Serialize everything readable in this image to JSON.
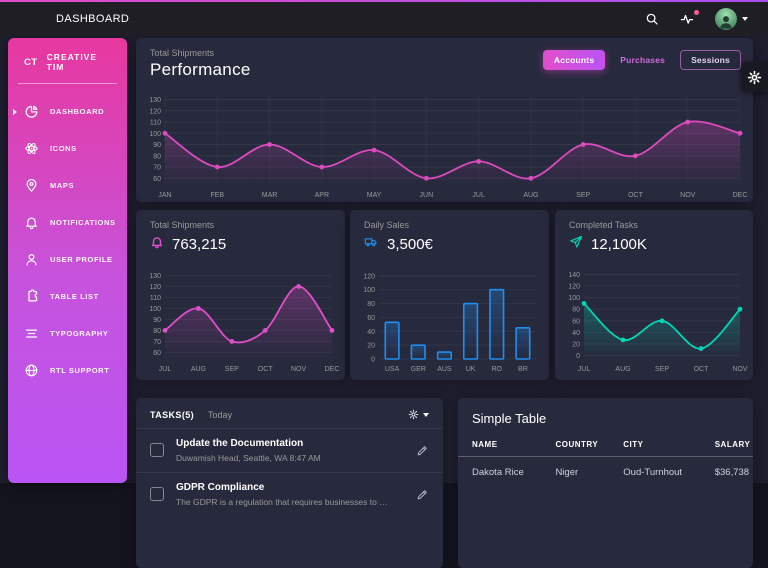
{
  "colors": {
    "page_bg": "#1e1e2f",
    "card_bg": "#27293d",
    "accent_pink": "#e14eca",
    "accent_purple": "#ba54f5",
    "accent_blue": "#1f8ef1",
    "accent_teal": "#00d6b4",
    "notification_red": "#fd5d93",
    "muted_text": "#9a9a9a"
  },
  "navbar": {
    "title": "DASHBOARD"
  },
  "sidebar": {
    "brand_initials": "CT",
    "brand_name": "CREATIVE TIM",
    "items": [
      {
        "label": "DASHBOARD",
        "icon": "chart-pie-icon",
        "active": true
      },
      {
        "label": "ICONS",
        "icon": "atom-icon",
        "active": false
      },
      {
        "label": "MAPS",
        "icon": "map-pin-icon",
        "active": false
      },
      {
        "label": "NOTIFICATIONS",
        "icon": "bell-icon",
        "active": false
      },
      {
        "label": "USER PROFILE",
        "icon": "user-icon",
        "active": false
      },
      {
        "label": "TABLE LIST",
        "icon": "puzzle-icon",
        "active": false
      },
      {
        "label": "TYPOGRAPHY",
        "icon": "align-center-icon",
        "active": false
      },
      {
        "label": "RTL SUPPORT",
        "icon": "globe-icon",
        "active": false
      }
    ]
  },
  "performance": {
    "subtitle": "Total Shipments",
    "title": "Performance",
    "tabs": [
      {
        "label": "Accounts",
        "active": true
      },
      {
        "label": "Purchases",
        "active": false
      },
      {
        "label": "Sessions",
        "active": false
      }
    ]
  },
  "stats": [
    {
      "label": "Total Shipments",
      "value": "763,215",
      "icon": "bell-icon"
    },
    {
      "label": "Daily Sales",
      "value": "3,500€",
      "icon": "delivery-truck-icon"
    },
    {
      "label": "Completed Tasks",
      "value": "12,100K",
      "icon": "send-icon"
    }
  ],
  "tasks": {
    "title": "TASKS(5)",
    "filter": "Today",
    "items": [
      {
        "title": "Update the Documentation",
        "meta": "Duwamish Head, Seattle, WA 8:47 AM"
      },
      {
        "title": "GDPR Compliance",
        "meta": "The GDPR is a regulation that requires businesses to protect the ..."
      }
    ]
  },
  "table": {
    "title": "Simple Table",
    "columns": [
      "NAME",
      "COUNTRY",
      "CITY",
      "SALARY"
    ],
    "rows": [
      [
        "Dakota Rice",
        "Niger",
        "Oud-Turnhout",
        "$36,738"
      ]
    ]
  },
  "chart_data": [
    {
      "type": "line",
      "title": "Performance (Total Shipments)",
      "categories": [
        "JAN",
        "FEB",
        "MAR",
        "APR",
        "MAY",
        "JUN",
        "JUL",
        "AUG",
        "SEP",
        "OCT",
        "NOV",
        "DEC"
      ],
      "values": [
        100,
        70,
        90,
        70,
        85,
        60,
        75,
        60,
        90,
        80,
        110,
        100
      ],
      "yticks": [
        60,
        70,
        80,
        90,
        100,
        110,
        120,
        130
      ],
      "ylim": [
        54,
        134
      ],
      "color": "#dd4bc0",
      "vgrid": true,
      "legend": "none"
    },
    {
      "type": "line",
      "title": "Total Shipments",
      "categories": [
        "JUL",
        "AUG",
        "SEP",
        "OCT",
        "NOV",
        "DEC"
      ],
      "values": [
        80,
        100,
        70,
        80,
        120,
        80
      ],
      "yticks": [
        60,
        70,
        80,
        90,
        100,
        110,
        120,
        130
      ],
      "ylim": [
        54,
        134
      ],
      "color": "#e14eca",
      "legend": "none"
    },
    {
      "type": "bar",
      "title": "Daily Sales",
      "categories": [
        "USA",
        "GER",
        "AUS",
        "UK",
        "RO",
        "BR"
      ],
      "values": [
        53,
        20,
        10,
        80,
        100,
        45
      ],
      "yticks": [
        0,
        20,
        40,
        60,
        80,
        100,
        120
      ],
      "ylim": [
        0,
        127
      ],
      "color": "#1f8ef1",
      "legend": "none"
    },
    {
      "type": "line",
      "title": "Completed Tasks",
      "categories": [
        "JUL",
        "AUG",
        "SEP",
        "OCT",
        "NOV"
      ],
      "values": [
        90,
        27,
        60,
        12,
        80
      ],
      "yticks": [
        0,
        20,
        40,
        60,
        80,
        100,
        120,
        140
      ],
      "ylim": [
        -6,
        146
      ],
      "color": "#00d6b4",
      "legend": "none"
    }
  ]
}
